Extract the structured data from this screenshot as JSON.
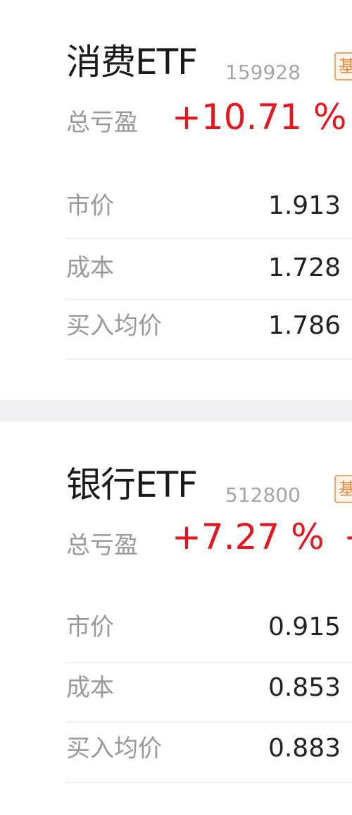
{
  "cards": [
    {
      "name": "消费ETF",
      "code": "159928",
      "tag": "基",
      "total_pl_label": "总亏盈",
      "total_pl_value": "+10.71 %",
      "rows": [
        {
          "label": "市价",
          "value": "1.913"
        },
        {
          "label": "成本",
          "value": "1.728"
        },
        {
          "label": "买入均价",
          "value": "1.786"
        }
      ]
    },
    {
      "name": "银行ETF",
      "code": "512800",
      "tag": "基",
      "total_pl_label": "总亏盈",
      "total_pl_value": "+7.27 %",
      "total_pl_extra": "+",
      "rows": [
        {
          "label": "市价",
          "value": "0.915"
        },
        {
          "label": "成本",
          "value": "0.853"
        },
        {
          "label": "买入均价",
          "value": "0.883"
        }
      ]
    }
  ],
  "colors": {
    "gain": "#e5161e",
    "label": "#999999",
    "value": "#222222",
    "tag_border": "#f0a66a",
    "separator": "#efeff4"
  }
}
